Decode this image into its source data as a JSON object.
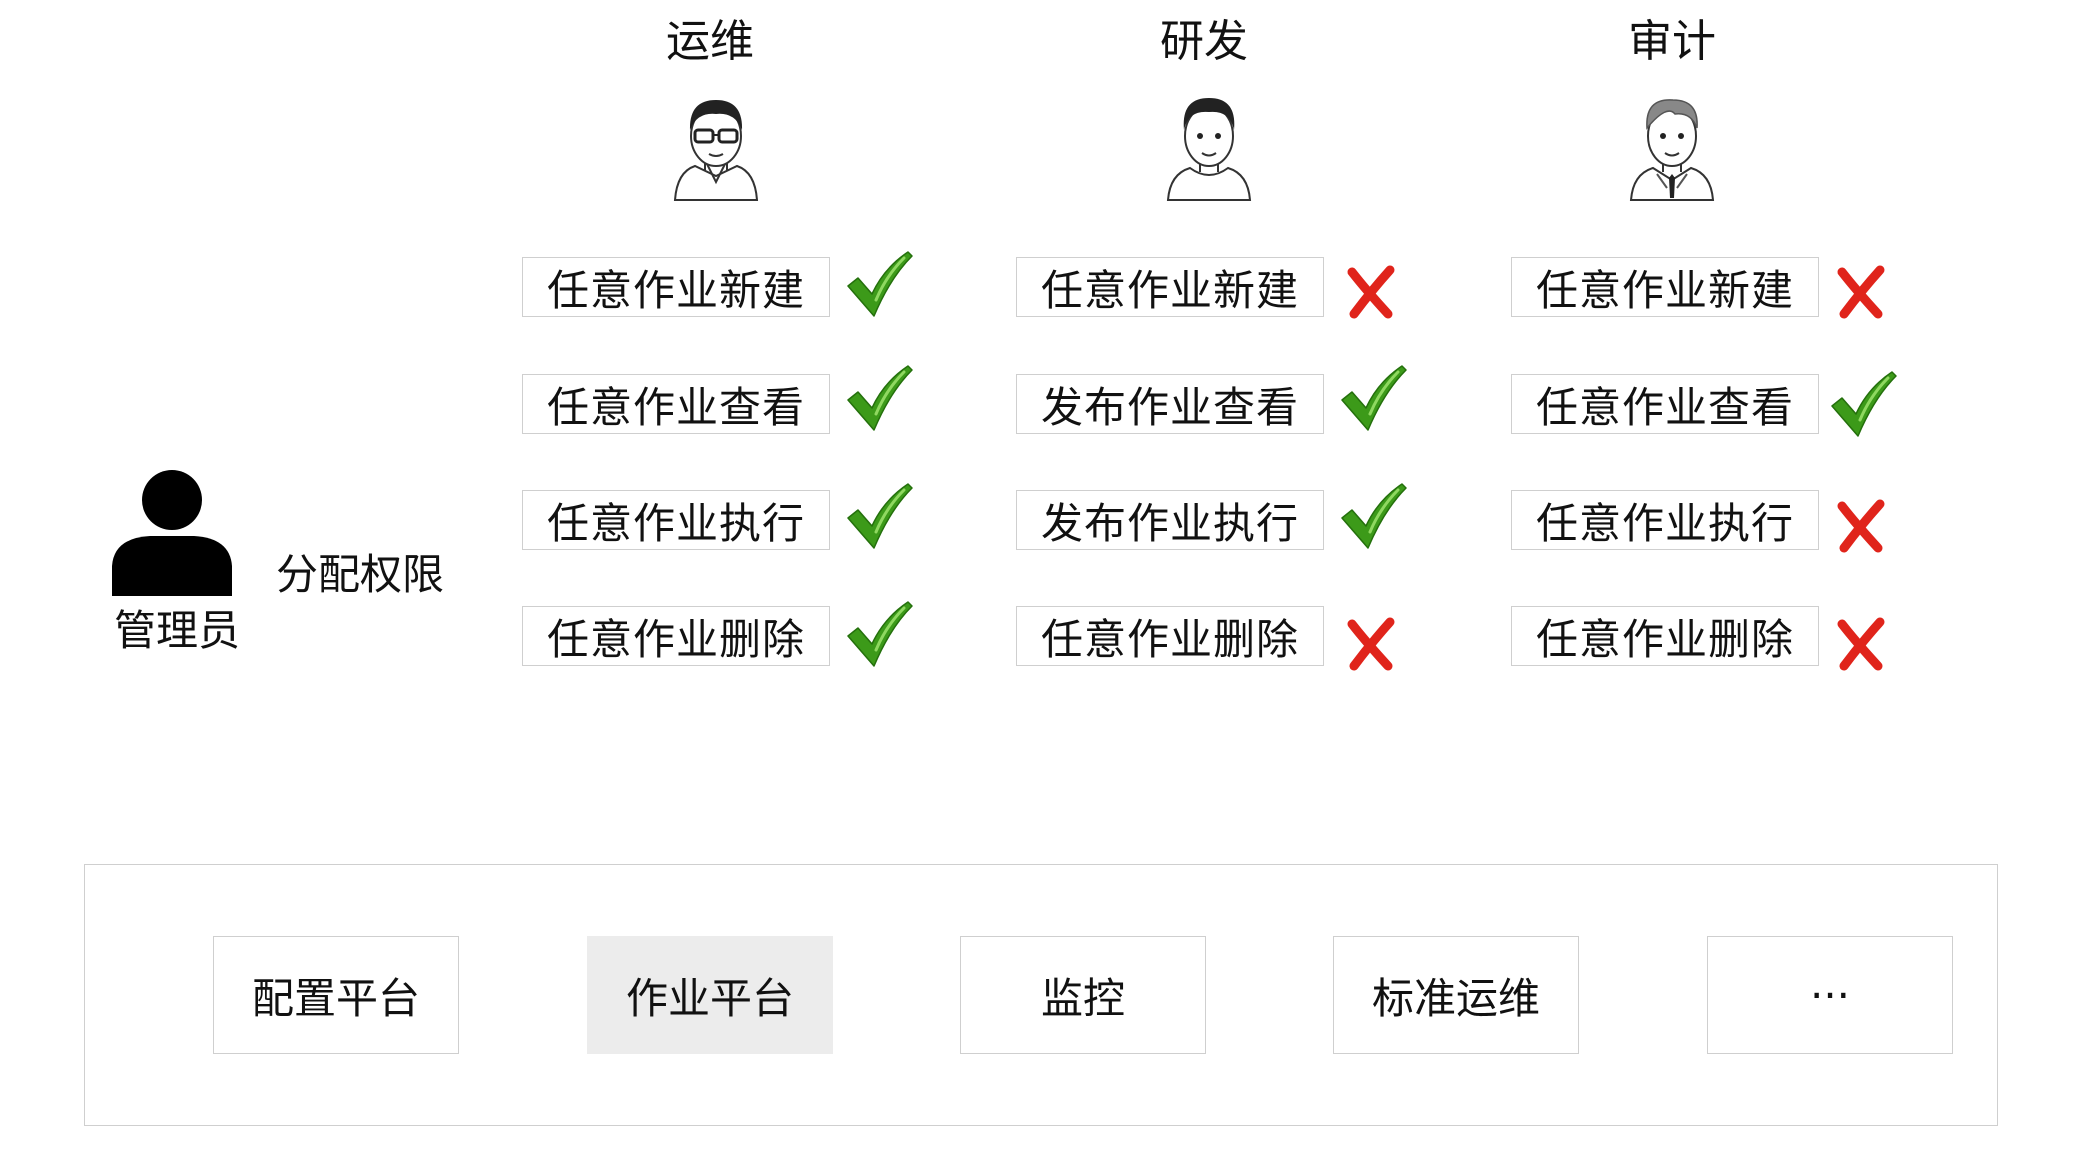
{
  "roles": [
    {
      "title": "运维",
      "permissions": [
        {
          "label": "任意作业新建",
          "granted": true
        },
        {
          "label": "任意作业查看",
          "granted": true
        },
        {
          "label": "任意作业执行",
          "granted": true
        },
        {
          "label": "任意作业删除",
          "granted": true
        }
      ]
    },
    {
      "title": "研发",
      "permissions": [
        {
          "label": "任意作业新建",
          "granted": false
        },
        {
          "label": "发布作业查看",
          "granted": true
        },
        {
          "label": "发布作业执行",
          "granted": true
        },
        {
          "label": "任意作业删除",
          "granted": false
        }
      ]
    },
    {
      "title": "审计",
      "permissions": [
        {
          "label": "任意作业新建",
          "granted": false
        },
        {
          "label": "任意作业查看",
          "granted": true
        },
        {
          "label": "任意作业执行",
          "granted": false
        },
        {
          "label": "任意作业删除",
          "granted": false
        }
      ]
    }
  ],
  "admin": {
    "label": "管理员"
  },
  "assign_label": "分配权限",
  "platforms": [
    {
      "label": "配置平台",
      "active": false
    },
    {
      "label": "作业平台",
      "active": true
    },
    {
      "label": "监控",
      "active": false
    },
    {
      "label": "标准运维",
      "active": false
    },
    {
      "label": "···",
      "active": false
    }
  ],
  "colors": {
    "check": "#3c9a19",
    "cross": "#e0241b",
    "border": "#cfcfcf",
    "active_bg": "#ececec"
  },
  "icons": {
    "granted": "checkmark-icon",
    "denied": "cross-icon",
    "admin": "person-silhouette-icon",
    "role_avatars": [
      "glasses-person-avatar-icon",
      "person-avatar-icon",
      "tie-person-avatar-icon"
    ]
  }
}
